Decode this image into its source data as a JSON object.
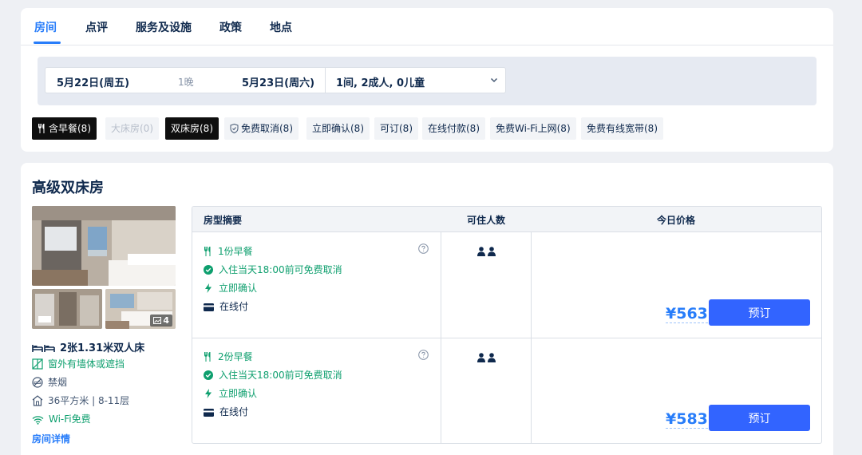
{
  "tabs": [
    {
      "label": "房间",
      "active": true
    },
    {
      "label": "点评"
    },
    {
      "label": "服务及设施"
    },
    {
      "label": "政策"
    },
    {
      "label": "地点"
    }
  ],
  "search": {
    "checkin": "5月22日(周五)",
    "nights": "1晚",
    "checkout": "5月23日(周六)",
    "guests": "1间, 2成人, 0儿童"
  },
  "filters": [
    {
      "label": "含早餐(8)",
      "state": "selected",
      "icon": "utensils-icon"
    },
    {
      "label": "大床房(0)",
      "state": "disabled"
    },
    {
      "label": "双床房(8)",
      "state": "selected"
    },
    {
      "label": "免费取消(8)",
      "state": "normal",
      "icon": "shield-check-icon"
    },
    {
      "label": "立即确认(8)",
      "state": "normal"
    },
    {
      "label": "可订(8)",
      "state": "normal"
    },
    {
      "label": "在线付款(8)",
      "state": "normal"
    },
    {
      "label": "免费Wi-Fi上网(8)",
      "state": "normal"
    },
    {
      "label": "免费有线宽带(8)",
      "state": "normal"
    }
  ],
  "room": {
    "title": "高级双床房",
    "photo_count": "4",
    "bed": "2张1.31米双人床",
    "window": "窗外有墙体或遮挡",
    "smoking": "禁烟",
    "area": "36平方米 | 8-11层",
    "wifi": "Wi-Fi免费",
    "details_link": "房间详情"
  },
  "table": {
    "headers": {
      "summary": "房型摘要",
      "occupancy": "可住人数",
      "price": "今日价格"
    },
    "rows": [
      {
        "breakfast": "1份早餐",
        "cancel": "入住当天18:00前可免费取消",
        "confirm": "立即确认",
        "payment": "在线付",
        "price": "¥563",
        "book": "预订"
      },
      {
        "breakfast": "2份早餐",
        "cancel": "入住当天18:00前可免费取消",
        "confirm": "立即确认",
        "payment": "在线付",
        "price": "¥583",
        "book": "预订"
      }
    ]
  },
  "colors": {
    "accent": "#287dfa",
    "button": "#3264ff",
    "green": "#0e9f6e",
    "text": "#0f294d"
  }
}
